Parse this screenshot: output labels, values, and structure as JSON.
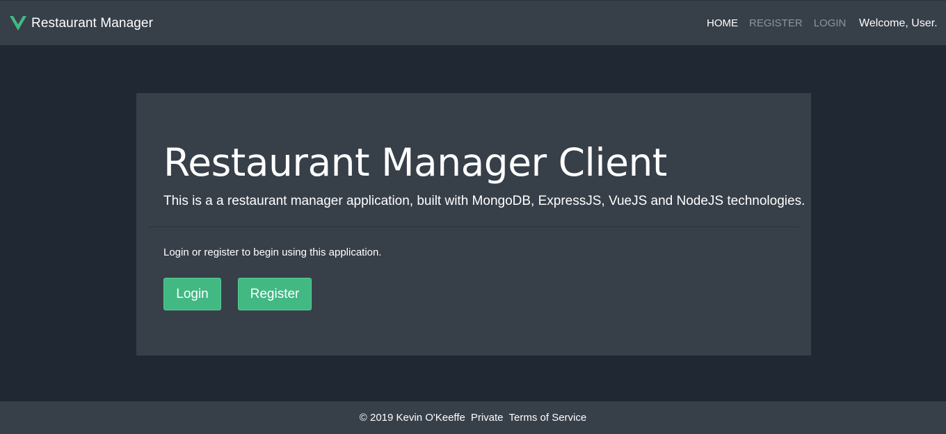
{
  "navbar": {
    "brand": "Restaurant Manager",
    "logo_icon": "vue-logo-icon",
    "accent_color": "#42b883",
    "links": [
      {
        "label": "HOME",
        "active": true
      },
      {
        "label": "REGISTER",
        "active": false
      },
      {
        "label": "LOGIN",
        "active": false
      }
    ],
    "welcome": "Welcome, User."
  },
  "jumbotron": {
    "title": "Restaurant Manager Client",
    "lead": "This is a a restaurant manager application, built with MongoDB, ExpressJS, VueJS and NodeJS technologies.",
    "text": "Login or register to begin using this application.",
    "login_button": "Login",
    "register_button": "Register"
  },
  "footer": {
    "copyright": "© 2019 Kevin O'Keeffe",
    "private_link": "Private",
    "terms_link": "Terms of Service"
  }
}
